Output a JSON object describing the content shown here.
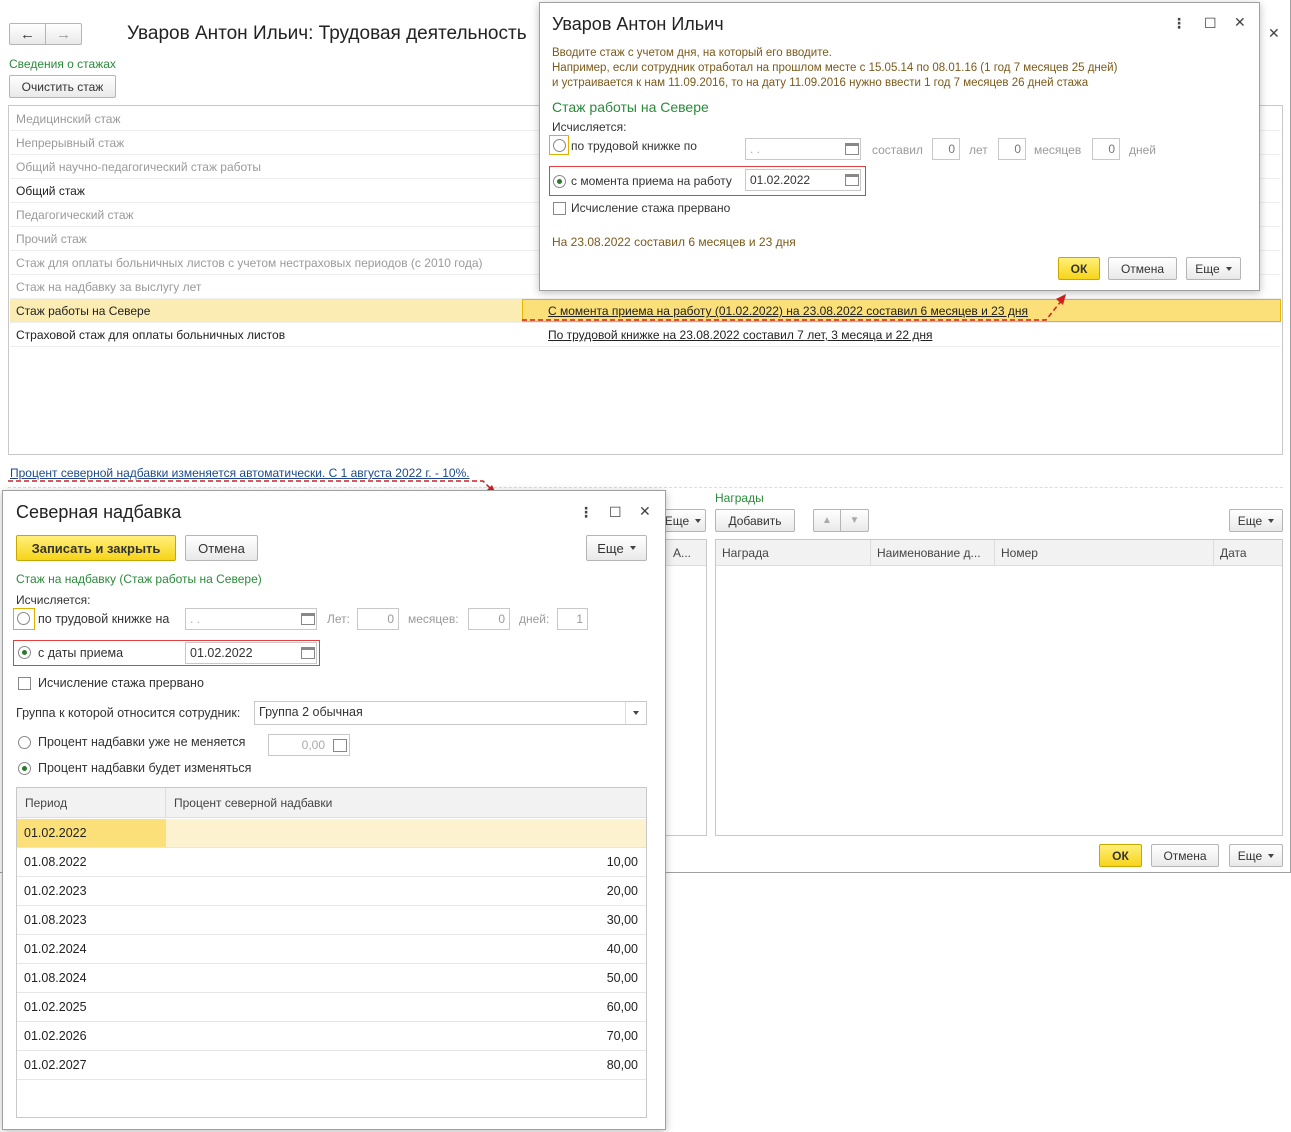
{
  "main": {
    "title": "Уваров Антон Ильич: Трудовая деятельность",
    "section_stazh": "Сведения о стажах",
    "clear_btn": "Очистить стаж",
    "rows": [
      {
        "name": "Медицинский стаж",
        "value": "",
        "state": "grey"
      },
      {
        "name": "Непрерывный стаж",
        "value": "",
        "state": "grey"
      },
      {
        "name": "Общий научно-педагогический стаж работы",
        "value": "",
        "state": "grey"
      },
      {
        "name": "Общий стаж",
        "value": "",
        "state": "normal"
      },
      {
        "name": "Педагогический стаж",
        "value": "",
        "state": "grey"
      },
      {
        "name": "Прочий стаж",
        "value": "",
        "state": "grey"
      },
      {
        "name": "Стаж для оплаты больничных листов с учетом нестраховых периодов (с 2010 года)",
        "value": "",
        "state": "grey"
      },
      {
        "name": "Стаж на надбавку за выслугу лет",
        "value": "",
        "state": "grey"
      },
      {
        "name": "Стаж работы на Севере",
        "value": "С момента приема на работу (01.02.2022) на 23.08.2022 составил 6 месяцев и 23 дня",
        "state": "selected"
      },
      {
        "name": "Страховой стаж для оплаты больничных листов",
        "value": "По трудовой книжке на 23.08.2022 составил 7 лет, 3 месяца и 22 дня",
        "state": "normal"
      }
    ],
    "north_link": "Процент северной надбавки изменяется автоматически. С 1 августа 2022 г. - 10%.",
    "awards_title": "Награды",
    "add_btn": "Добавить",
    "more_btn": "Еще",
    "awards_cols": [
      "Награда",
      "Наименование д...",
      "Номер",
      "Дата"
    ],
    "left_col_partial": "А...",
    "ok": "ОК",
    "cancel": "Отмена"
  },
  "dlg1": {
    "title": "Уваров Антон Ильич",
    "hint1": "Вводите стаж с учетом дня, на который его вводите.",
    "hint2": "Например, если сотрудник отработал на прошлом месте с 15.05.14 по 08.01.16 (1 год 7 месяцев 25 дней)",
    "hint3": "и устраивается к нам 11.09.2016, то на дату 11.09.2016 нужно ввести 1 год 7 месяцев 26 дней стажа",
    "section": "Стаж работы на Севере",
    "calc_label": "Исчисляется:",
    "opt_book": "по трудовой книжке по",
    "book_date": " .  .",
    "sostavil": "составил",
    "years_val": "0",
    "years": "лет",
    "months_val": "0",
    "months": "месяцев",
    "days_val": "0",
    "days": "дней",
    "opt_hire": "с момента приема на работу",
    "hire_date": "01.02.2022",
    "interrupted": "Исчисление стажа прервано",
    "result": "На 23.08.2022 составил 6 месяцев и 23 дня",
    "ok": "ОК",
    "cancel": "Отмена",
    "more": "Еще"
  },
  "dlg2": {
    "title": "Северная надбавка",
    "save_close": "Записать и закрыть",
    "cancel": "Отмена",
    "more": "Еще",
    "section": "Стаж на надбавку (Стаж работы на Севере)",
    "calc_label": "Исчисляется:",
    "opt_book": "по трудовой книжке на",
    "book_date": " .  .",
    "years": "Лет:",
    "years_val": "0",
    "months": "месяцев:",
    "months_val": "0",
    "days": "дней:",
    "days_val": "1",
    "opt_hire": "с даты приема",
    "hire_date": "01.02.2022",
    "interrupted": "Исчисление стажа прервано",
    "group_label": "Группа к которой относится сотрудник:",
    "group_value": "Группа 2 обычная",
    "fixed_label": "Процент надбавки уже не меняется",
    "fixed_value": "0,00",
    "changing_label": "Процент надбавки будет изменяться",
    "col_period": "Период",
    "col_percent": "Процент северной надбавки",
    "periods": [
      {
        "period": "01.02.2022",
        "percent": ""
      },
      {
        "period": "01.08.2022",
        "percent": "10,00"
      },
      {
        "period": "01.02.2023",
        "percent": "20,00"
      },
      {
        "period": "01.08.2023",
        "percent": "30,00"
      },
      {
        "period": "01.02.2024",
        "percent": "40,00"
      },
      {
        "period": "01.08.2024",
        "percent": "50,00"
      },
      {
        "period": "01.02.2025",
        "percent": "60,00"
      },
      {
        "period": "01.02.2026",
        "percent": "70,00"
      },
      {
        "period": "01.02.2027",
        "percent": "80,00"
      }
    ]
  }
}
